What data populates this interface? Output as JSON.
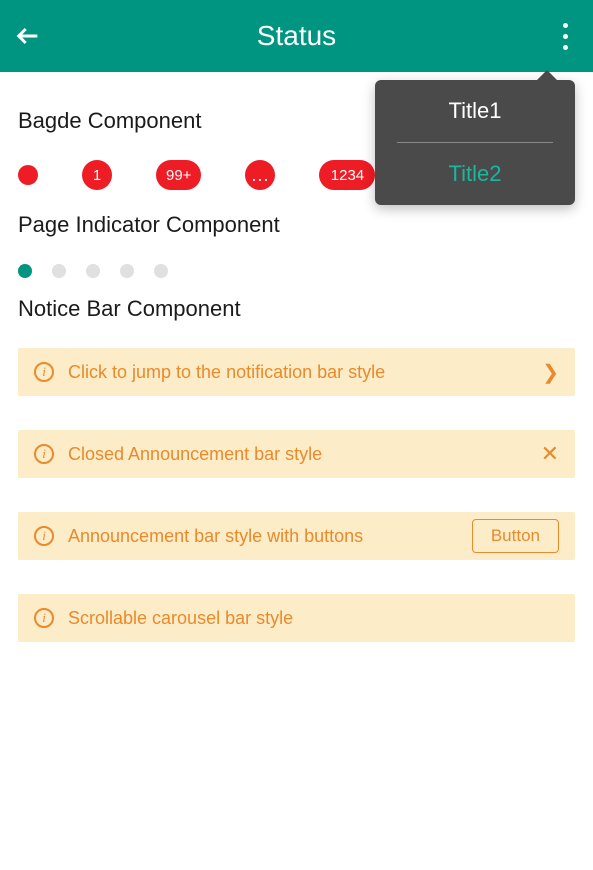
{
  "header": {
    "title": "Status"
  },
  "menu": {
    "items": [
      "Title1",
      "Title2"
    ]
  },
  "sections": {
    "badge_title": "Bagde Component",
    "page_indicator_title": "Page Indicator Component",
    "notice_title": "Notice Bar Component"
  },
  "badges": {
    "b1": "",
    "b2": "1",
    "b3": "99+",
    "b4": "...",
    "b5": "1234",
    "b6": ""
  },
  "notices": {
    "n1": "Click to jump to the notification bar style",
    "n2": "Closed Announcement bar style",
    "n3": "Announcement bar style with buttons",
    "n3_button": "Button",
    "n4": "Scrollable carousel bar style"
  }
}
